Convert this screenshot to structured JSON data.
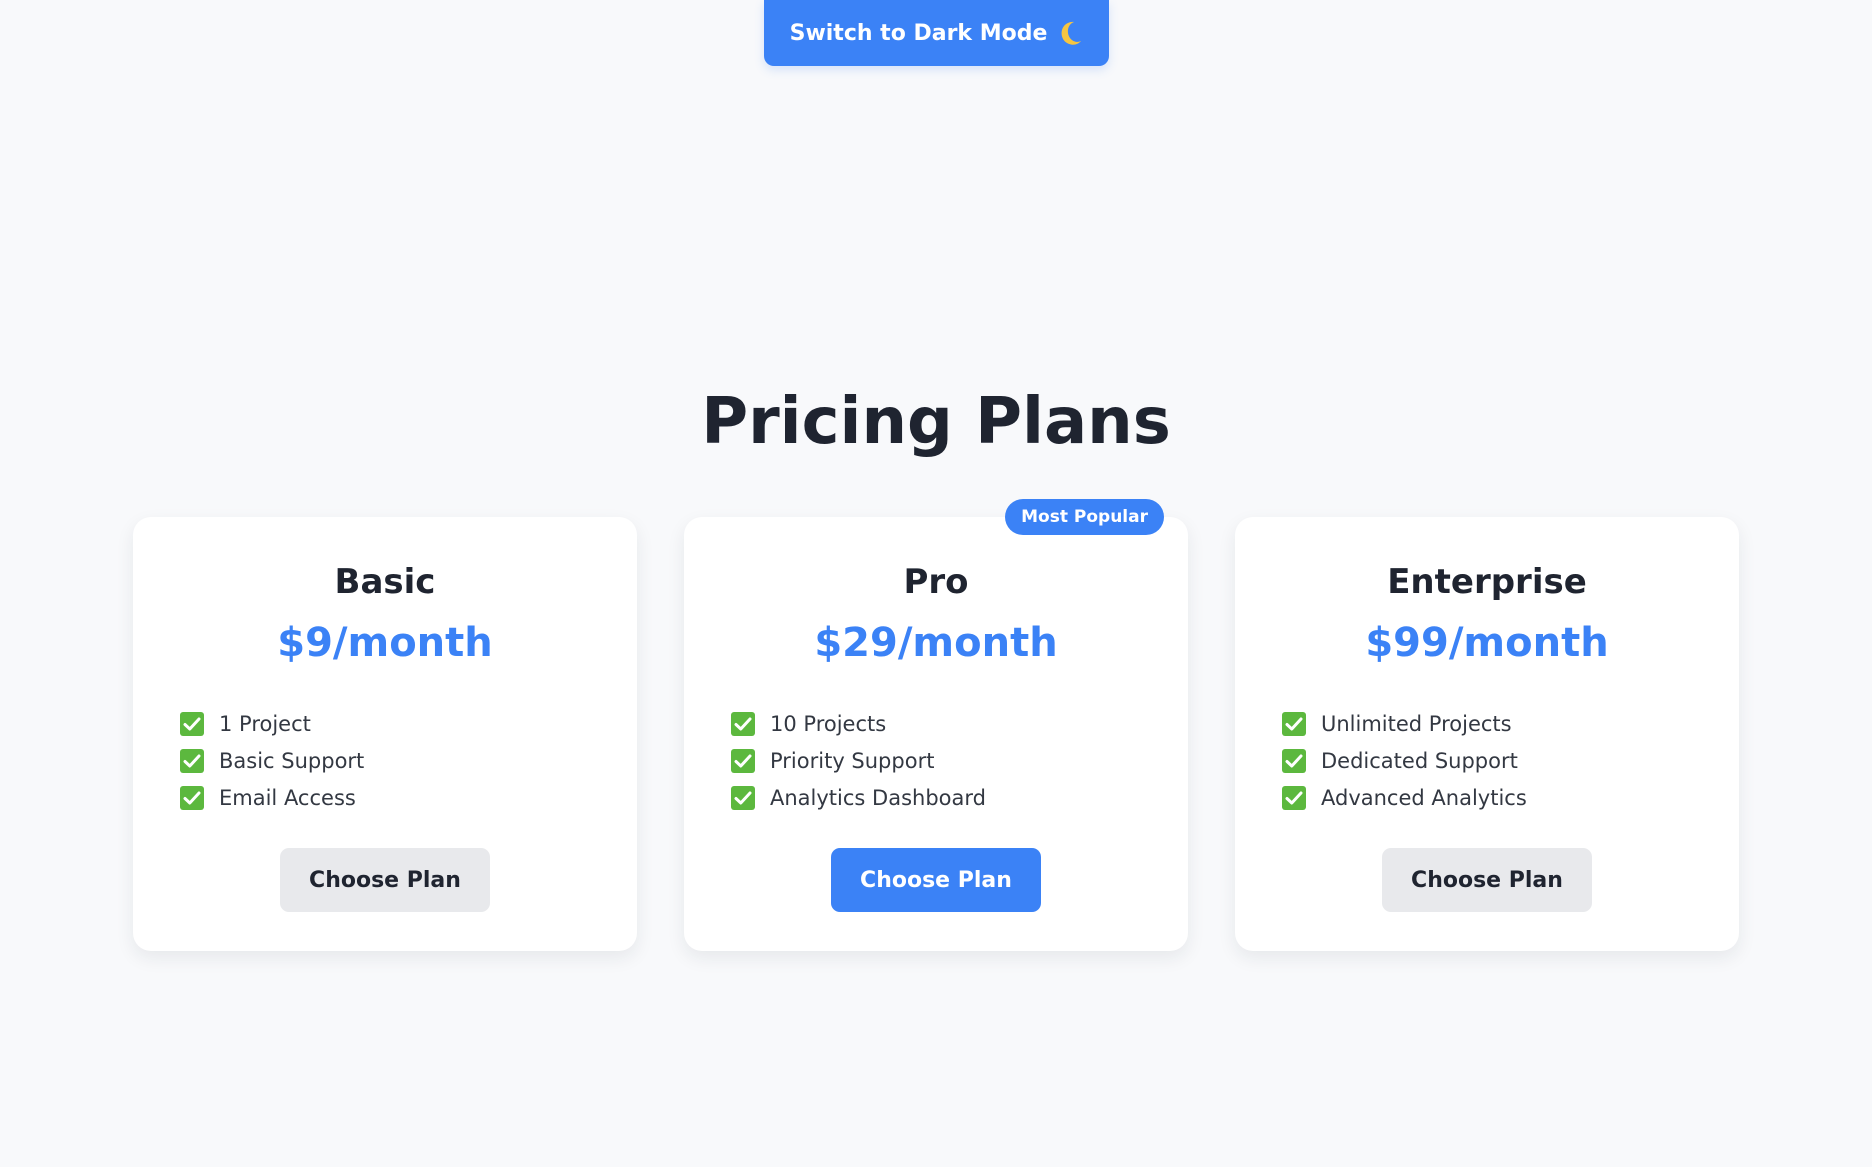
{
  "theme_toggle": {
    "label": "Switch to Dark Mode",
    "icon": "moon-icon"
  },
  "page_title": "Pricing Plans",
  "accent_color": "#3b82f6",
  "check_icon_color": "#5cb83e",
  "plans": [
    {
      "name": "Basic",
      "price": "$9/month",
      "features": [
        "1 Project",
        "Basic Support",
        "Email Access"
      ],
      "button_label": "Choose Plan",
      "highlighted": false
    },
    {
      "name": "Pro",
      "price": "$29/month",
      "badge": "Most Popular",
      "features": [
        "10 Projects",
        "Priority Support",
        "Analytics Dashboard"
      ],
      "button_label": "Choose Plan",
      "highlighted": true
    },
    {
      "name": "Enterprise",
      "price": "$99/month",
      "features": [
        "Unlimited Projects",
        "Dedicated Support",
        "Advanced Analytics"
      ],
      "button_label": "Choose Plan",
      "highlighted": false
    }
  ]
}
